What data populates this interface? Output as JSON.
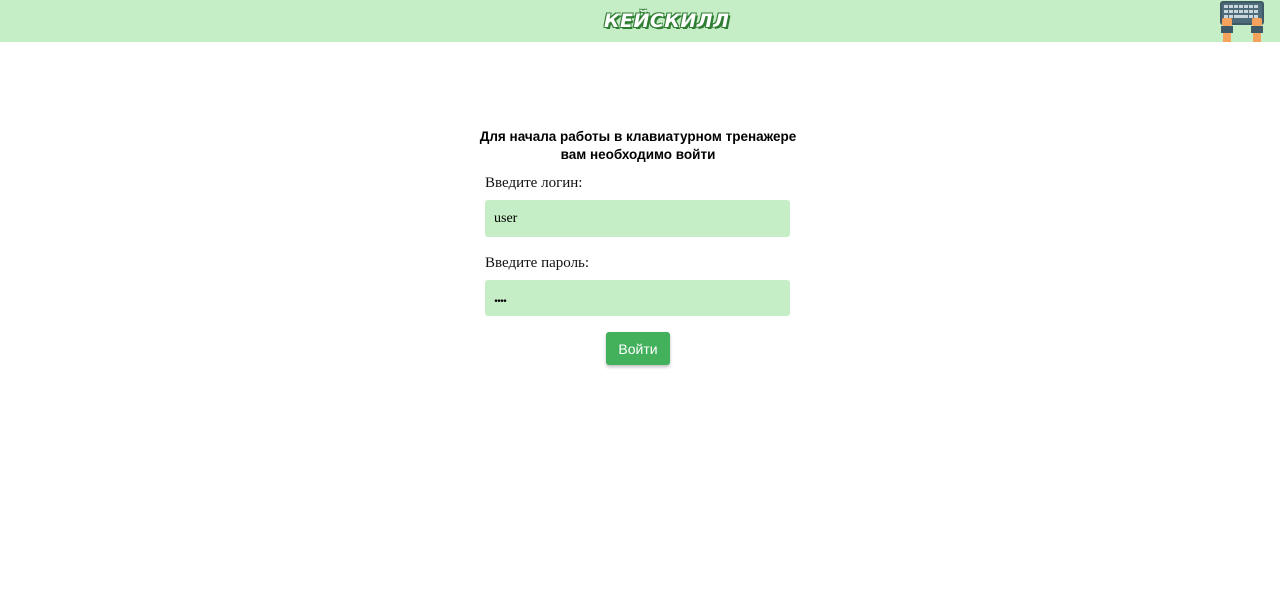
{
  "header": {
    "logo_text": "КЕЙСКИЛЛ",
    "background_color": "#c6eec6",
    "profile_icon": "keyboard-typing-icon"
  },
  "login": {
    "heading": "Для начала работы в клавиатурном тренажере вам необходимо войти",
    "login_label": "Введите логин:",
    "login_value": "user",
    "password_label": "Введите пароль:",
    "password_value": "....",
    "submit_label": "Войти",
    "input_color": "#c6eec6",
    "button_color": "#43b05c"
  }
}
